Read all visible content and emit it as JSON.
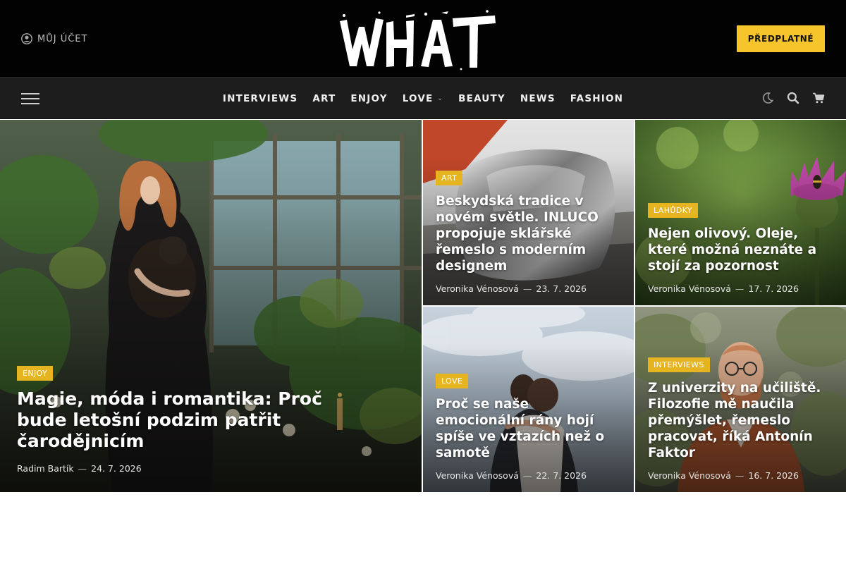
{
  "header": {
    "account_label": "MŮJ ÚČET",
    "logo_text": "WHAT",
    "subscribe_label": "PŘEDPLATNÉ"
  },
  "nav": {
    "items": [
      {
        "label": "INTERVIEWS"
      },
      {
        "label": "ART"
      },
      {
        "label": "ENJOY"
      },
      {
        "label": "LOVE"
      },
      {
        "label": "BEAUTY"
      },
      {
        "label": "NEWS"
      },
      {
        "label": "FASHION"
      }
    ],
    "icons": [
      "moon-icon",
      "search-icon",
      "cart-icon"
    ]
  },
  "articles": [
    {
      "tag": "ENJOY",
      "title": "Magie, móda i romantika: Proč bude letošní podzim patřit čarodějnicím",
      "author": "Radim Bartík",
      "date": "24. 7. 2026"
    },
    {
      "tag": "ART",
      "title": "Beskydská tradice v novém světle. INLUCO propojuje sklářské řemeslo s moderním designem",
      "author": "Veronika Vénosová",
      "date": "23. 7. 2026"
    },
    {
      "tag": "LAHŮDKY",
      "title": "Nejen olivový. Oleje, které možná neznáte a stojí za pozornost",
      "author": "Veronika Vénosová",
      "date": "17. 7. 2026"
    },
    {
      "tag": "LOVE",
      "title": "Proč se naše emocionální rány hojí spíše ve vztazích než o samotě",
      "author": "Veronika Vénosová",
      "date": "22. 7. 2026"
    },
    {
      "tag": "INTERVIEWS",
      "title": "Z univerzity na učiliště. Filozofie mě naučila přemýšlet, řemeslo pracovat, říká Antonín Faktor",
      "author": "Veronika Vénosová",
      "date": "16. 7. 2026"
    }
  ],
  "colors": {
    "accent": "#f6c52b",
    "tag": "#e6b421",
    "topbar": "#020202",
    "navbar": "#1d1d1d"
  }
}
